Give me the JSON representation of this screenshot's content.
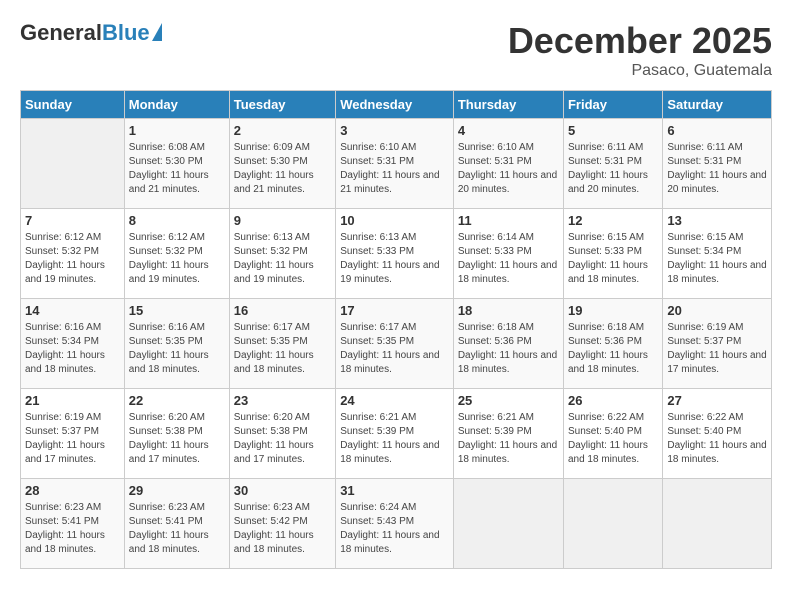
{
  "header": {
    "logo_general": "General",
    "logo_blue": "Blue",
    "main_title": "December 2025",
    "subtitle": "Pasaco, Guatemala"
  },
  "days_of_week": [
    "Sunday",
    "Monday",
    "Tuesday",
    "Wednesday",
    "Thursday",
    "Friday",
    "Saturday"
  ],
  "weeks": [
    [
      {
        "day": "",
        "info": ""
      },
      {
        "day": "1",
        "info": "Sunrise: 6:08 AM\nSunset: 5:30 PM\nDaylight: 11 hours and 21 minutes."
      },
      {
        "day": "2",
        "info": "Sunrise: 6:09 AM\nSunset: 5:30 PM\nDaylight: 11 hours and 21 minutes."
      },
      {
        "day": "3",
        "info": "Sunrise: 6:10 AM\nSunset: 5:31 PM\nDaylight: 11 hours and 21 minutes."
      },
      {
        "day": "4",
        "info": "Sunrise: 6:10 AM\nSunset: 5:31 PM\nDaylight: 11 hours and 20 minutes."
      },
      {
        "day": "5",
        "info": "Sunrise: 6:11 AM\nSunset: 5:31 PM\nDaylight: 11 hours and 20 minutes."
      },
      {
        "day": "6",
        "info": "Sunrise: 6:11 AM\nSunset: 5:31 PM\nDaylight: 11 hours and 20 minutes."
      }
    ],
    [
      {
        "day": "7",
        "info": "Sunrise: 6:12 AM\nSunset: 5:32 PM\nDaylight: 11 hours and 19 minutes."
      },
      {
        "day": "8",
        "info": "Sunrise: 6:12 AM\nSunset: 5:32 PM\nDaylight: 11 hours and 19 minutes."
      },
      {
        "day": "9",
        "info": "Sunrise: 6:13 AM\nSunset: 5:32 PM\nDaylight: 11 hours and 19 minutes."
      },
      {
        "day": "10",
        "info": "Sunrise: 6:13 AM\nSunset: 5:33 PM\nDaylight: 11 hours and 19 minutes."
      },
      {
        "day": "11",
        "info": "Sunrise: 6:14 AM\nSunset: 5:33 PM\nDaylight: 11 hours and 18 minutes."
      },
      {
        "day": "12",
        "info": "Sunrise: 6:15 AM\nSunset: 5:33 PM\nDaylight: 11 hours and 18 minutes."
      },
      {
        "day": "13",
        "info": "Sunrise: 6:15 AM\nSunset: 5:34 PM\nDaylight: 11 hours and 18 minutes."
      }
    ],
    [
      {
        "day": "14",
        "info": "Sunrise: 6:16 AM\nSunset: 5:34 PM\nDaylight: 11 hours and 18 minutes."
      },
      {
        "day": "15",
        "info": "Sunrise: 6:16 AM\nSunset: 5:35 PM\nDaylight: 11 hours and 18 minutes."
      },
      {
        "day": "16",
        "info": "Sunrise: 6:17 AM\nSunset: 5:35 PM\nDaylight: 11 hours and 18 minutes."
      },
      {
        "day": "17",
        "info": "Sunrise: 6:17 AM\nSunset: 5:35 PM\nDaylight: 11 hours and 18 minutes."
      },
      {
        "day": "18",
        "info": "Sunrise: 6:18 AM\nSunset: 5:36 PM\nDaylight: 11 hours and 18 minutes."
      },
      {
        "day": "19",
        "info": "Sunrise: 6:18 AM\nSunset: 5:36 PM\nDaylight: 11 hours and 18 minutes."
      },
      {
        "day": "20",
        "info": "Sunrise: 6:19 AM\nSunset: 5:37 PM\nDaylight: 11 hours and 17 minutes."
      }
    ],
    [
      {
        "day": "21",
        "info": "Sunrise: 6:19 AM\nSunset: 5:37 PM\nDaylight: 11 hours and 17 minutes."
      },
      {
        "day": "22",
        "info": "Sunrise: 6:20 AM\nSunset: 5:38 PM\nDaylight: 11 hours and 17 minutes."
      },
      {
        "day": "23",
        "info": "Sunrise: 6:20 AM\nSunset: 5:38 PM\nDaylight: 11 hours and 17 minutes."
      },
      {
        "day": "24",
        "info": "Sunrise: 6:21 AM\nSunset: 5:39 PM\nDaylight: 11 hours and 18 minutes."
      },
      {
        "day": "25",
        "info": "Sunrise: 6:21 AM\nSunset: 5:39 PM\nDaylight: 11 hours and 18 minutes."
      },
      {
        "day": "26",
        "info": "Sunrise: 6:22 AM\nSunset: 5:40 PM\nDaylight: 11 hours and 18 minutes."
      },
      {
        "day": "27",
        "info": "Sunrise: 6:22 AM\nSunset: 5:40 PM\nDaylight: 11 hours and 18 minutes."
      }
    ],
    [
      {
        "day": "28",
        "info": "Sunrise: 6:23 AM\nSunset: 5:41 PM\nDaylight: 11 hours and 18 minutes."
      },
      {
        "day": "29",
        "info": "Sunrise: 6:23 AM\nSunset: 5:41 PM\nDaylight: 11 hours and 18 minutes."
      },
      {
        "day": "30",
        "info": "Sunrise: 6:23 AM\nSunset: 5:42 PM\nDaylight: 11 hours and 18 minutes."
      },
      {
        "day": "31",
        "info": "Sunrise: 6:24 AM\nSunset: 5:43 PM\nDaylight: 11 hours and 18 minutes."
      },
      {
        "day": "",
        "info": ""
      },
      {
        "day": "",
        "info": ""
      },
      {
        "day": "",
        "info": ""
      }
    ]
  ]
}
